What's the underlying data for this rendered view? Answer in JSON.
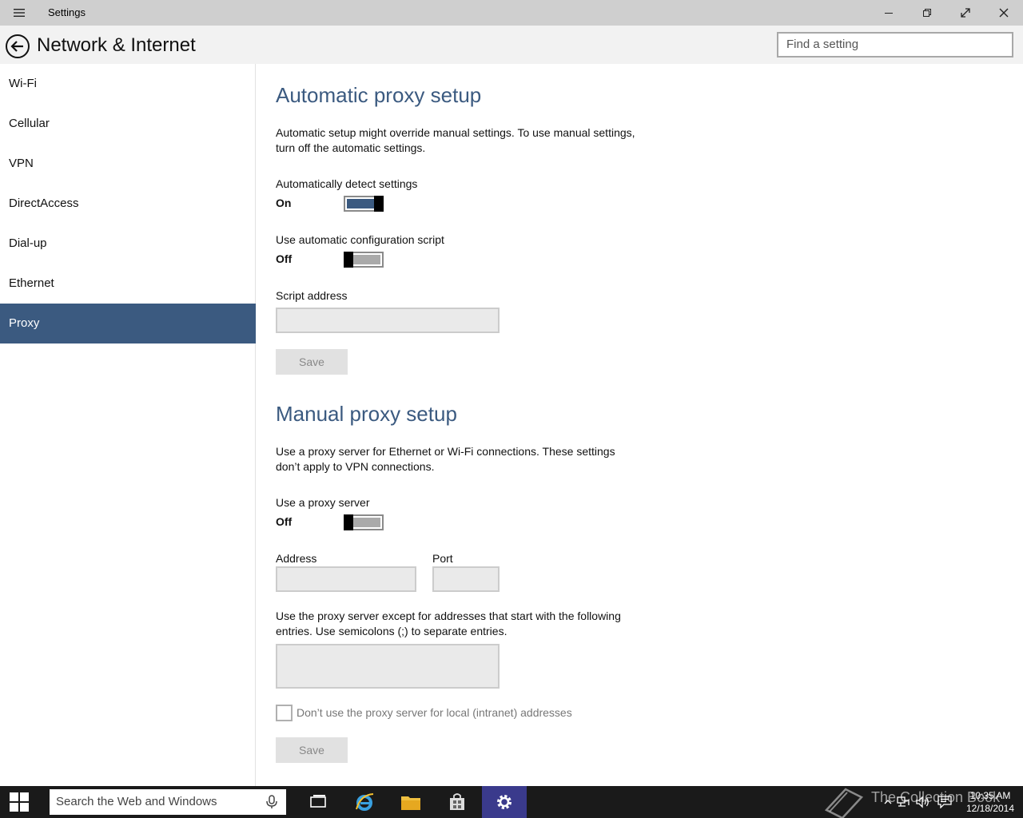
{
  "window": {
    "app_title": "Settings",
    "page_title": "Network & Internet",
    "search_placeholder": "Find a setting"
  },
  "sidebar": {
    "items": [
      {
        "label": "Wi-Fi"
      },
      {
        "label": "Cellular"
      },
      {
        "label": "VPN"
      },
      {
        "label": "DirectAccess"
      },
      {
        "label": "Dial-up"
      },
      {
        "label": "Ethernet"
      },
      {
        "label": "Proxy",
        "active": true
      }
    ]
  },
  "automatic": {
    "heading": "Automatic proxy setup",
    "description": "Automatic setup might override manual settings. To use manual settings, turn off the automatic settings.",
    "detect_label": "Automatically detect settings",
    "detect_state": "On",
    "script_label": "Use automatic configuration script",
    "script_state": "Off",
    "script_address_label": "Script address",
    "save_label": "Save"
  },
  "manual": {
    "heading": "Manual proxy setup",
    "description": "Use a proxy server for Ethernet or Wi-Fi connections. These settings don’t apply to VPN connections.",
    "use_proxy_label": "Use a proxy server",
    "use_proxy_state": "Off",
    "address_label": "Address",
    "port_label": "Port",
    "exceptions_description": "Use the proxy server except for addresses that start with the following entries. Use semicolons (;) to separate entries.",
    "local_checkbox_label": "Don’t use the proxy server for local (intranet) addresses",
    "save_label": "Save"
  },
  "taskbar": {
    "search_placeholder": "Search the Web and Windows",
    "time": "10:35 AM",
    "date": "12/18/2014",
    "watermark": "The Collection Book"
  },
  "colors": {
    "accent": "#3b5a80",
    "titlebar": "#cfcfcf",
    "taskbar": "#1a1a1a"
  }
}
